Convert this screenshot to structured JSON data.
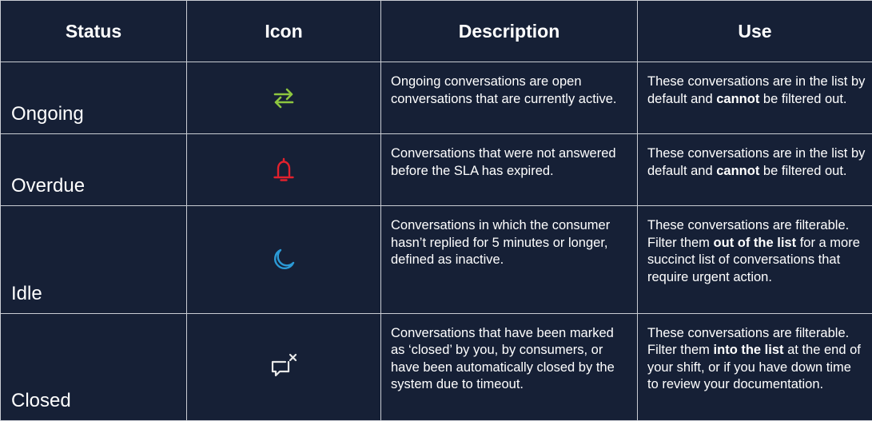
{
  "headers": {
    "status": "Status",
    "icon": "Icon",
    "description": "Description",
    "use": "Use"
  },
  "rows": [
    {
      "status": "Ongoing",
      "icon": "arrows-exchange-icon",
      "icon_color": "#8dc63f",
      "description": "Ongoing conversations are open conversations that are currently active.",
      "use": {
        "pre": "These conversations are in the list by default and ",
        "bold": "cannot",
        "post": " be filtered out."
      }
    },
    {
      "status": "Overdue",
      "icon": "bell-icon",
      "icon_color": "#e3212d",
      "description": "Conversations that were not answered before the SLA has expired.",
      "use": {
        "pre": "These conversations are in the list by default and ",
        "bold": "cannot",
        "post": " be filtered out."
      }
    },
    {
      "status": "Idle",
      "icon": "moon-icon",
      "icon_color": "#2b9ad6",
      "description": "Conversations in which the consumer hasn’t replied for 5 minutes or longer, defined as inactive.",
      "use": {
        "pre": "These conversations are filterable. Filter them ",
        "bold": "out of the list",
        "post": " for a more succinct list of conversations that require urgent action."
      }
    },
    {
      "status": "Closed",
      "icon": "chat-close-icon",
      "icon_color": "#e8e8e8",
      "description": "Conversations that have been marked as ‘closed’ by you, by consumers, or have been automatically closed by the system due to timeout.",
      "use": {
        "pre": "These conversations are filterable. Filter them ",
        "bold": "into the list",
        "post": " at the end of your shift, or if you have down time to review your documentation."
      }
    }
  ]
}
